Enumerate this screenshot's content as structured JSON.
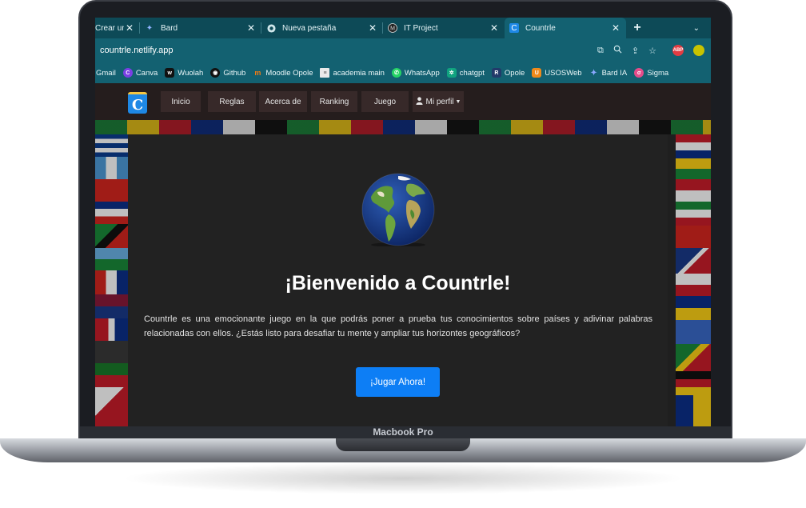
{
  "device": {
    "label": "Macbook Pro"
  },
  "tabs": [
    {
      "label": "Crear un",
      "favicon": "bard-sparkle-icon",
      "active": false
    },
    {
      "label": "Bard",
      "favicon": "bard-sparkle-icon",
      "active": false
    },
    {
      "label": "Nueva pestaña",
      "favicon": "chrome-icon",
      "active": false
    },
    {
      "label": "IT Project",
      "favicon": "m-circle-icon",
      "active": false
    },
    {
      "label": "Countrle",
      "favicon": "countrle-icon",
      "active": true
    }
  ],
  "address": {
    "url": "countrle.netlify.app"
  },
  "extensions": [
    {
      "label": "ABP",
      "color": "#e23c42"
    },
    {
      "label": "",
      "color": "#c8c300"
    }
  ],
  "bookmarks": [
    {
      "label": "Gmail",
      "icon": "",
      "color": ""
    },
    {
      "label": "Canva",
      "icon": "C",
      "color": "#7a3fe4"
    },
    {
      "label": "Wuolah",
      "icon": "W",
      "color": "#111111"
    },
    {
      "label": "Github",
      "icon": "github-icon",
      "color": "#111111"
    },
    {
      "label": "Moodle Opole",
      "icon": "m",
      "color": "#f07a14"
    },
    {
      "label": "academia main",
      "icon": "doc",
      "color": "#e9e9e9"
    },
    {
      "label": "WhatsApp",
      "icon": "whatsapp-icon",
      "color": "#25d366"
    },
    {
      "label": "chatgpt",
      "icon": "gpt",
      "color": "#10a37f"
    },
    {
      "label": "Opole",
      "icon": "R",
      "color": "#223a6a"
    },
    {
      "label": "USOSWeb",
      "icon": "U",
      "color": "#f08a1a"
    },
    {
      "label": "Bard IA",
      "icon": "sparkle",
      "color": "#8aa8ff"
    },
    {
      "label": "Sigma",
      "icon": "s",
      "color": "#e44c8a"
    }
  ],
  "nav": {
    "logo_letter": "C",
    "items": [
      "Inicio",
      "Reglas",
      "Acerca de",
      "Ranking",
      "Juego"
    ],
    "profile": "Mi perfil"
  },
  "hero": {
    "title": "¡Bienvenido a Countrle!",
    "description": "Countrle es una emocionante juego en la que podrás poner a prueba tus conocimientos sobre países y adivinar palabras relacionadas con ellos. ¿Estás listo para desafiar tu mente y ampliar tus horizontes geográficos?",
    "button": "¡Jugar Ahora!"
  },
  "colors": {
    "accent": "#0d7ef5",
    "chrome": "#136171"
  }
}
